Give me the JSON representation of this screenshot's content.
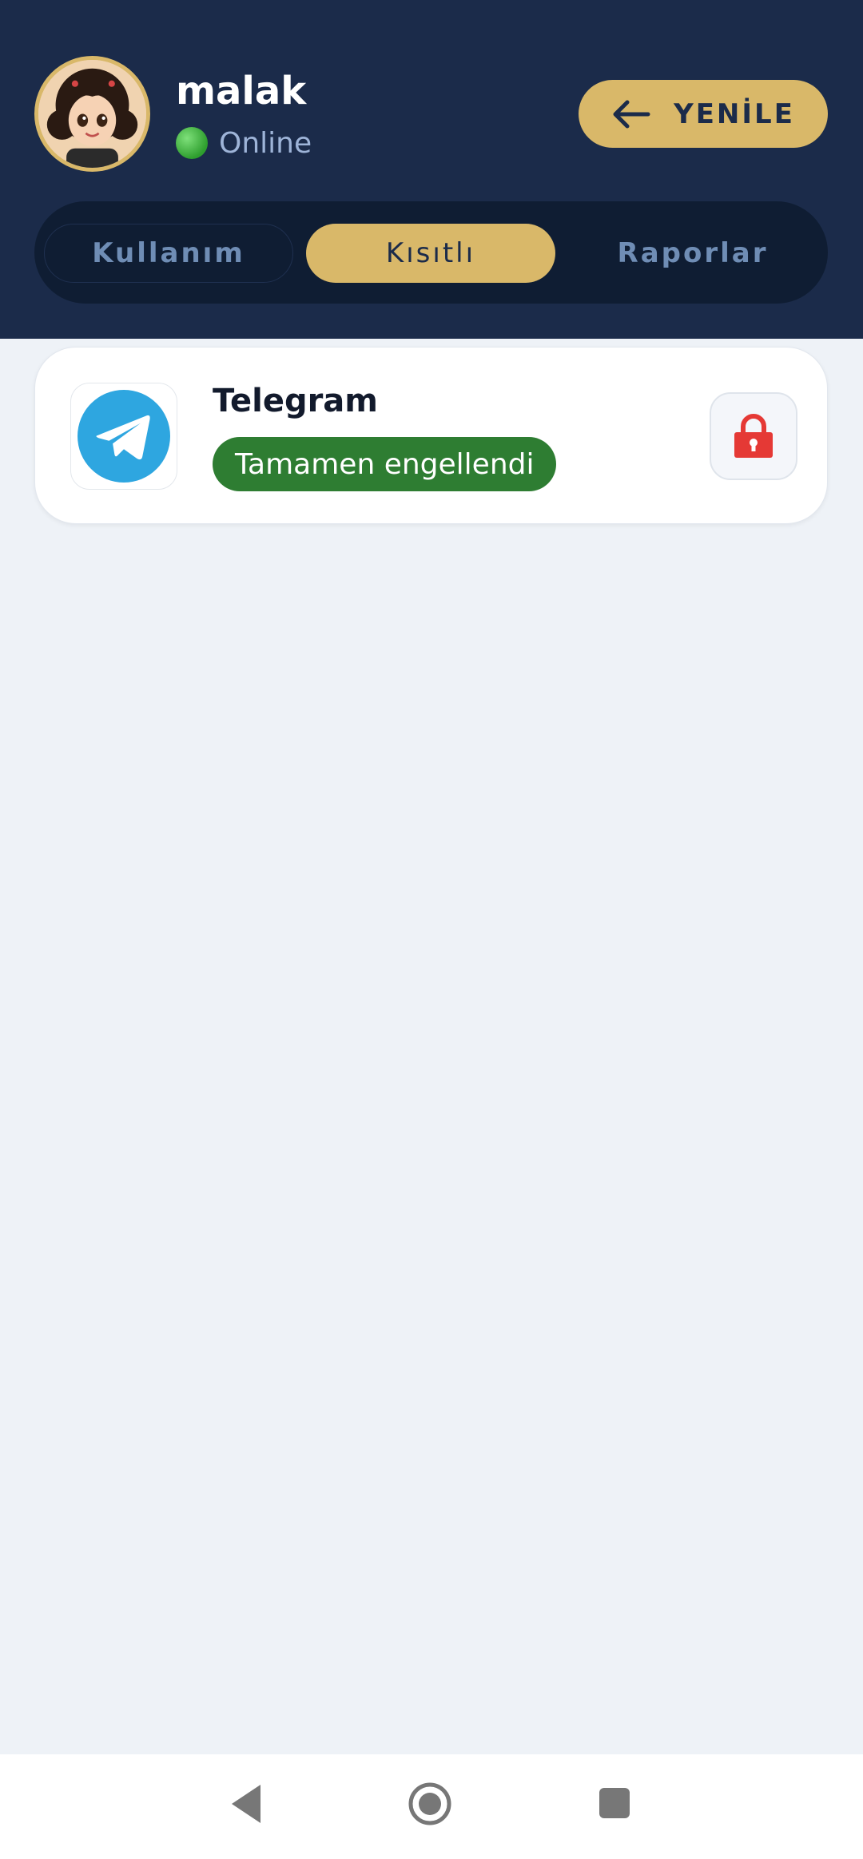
{
  "header": {
    "username": "malak",
    "status": "Online",
    "refresh_label": "YENİLE"
  },
  "tabs": [
    {
      "label": "Kullanım",
      "selected": false
    },
    {
      "label": "Kısıtlı",
      "selected": true
    },
    {
      "label": "Raporlar",
      "selected": false
    }
  ],
  "apps": [
    {
      "name": "Telegram",
      "status": "Tamamen engellendi",
      "icon": "telegram-icon",
      "lock_icon": "lock-icon"
    }
  ],
  "colors": {
    "header_bg": "#1b2b4a",
    "accent_gold": "#d9b869",
    "blocked_green": "#2e7d32",
    "lock_red": "#e53935",
    "telegram_blue": "#2ea6e0"
  },
  "navigation": {
    "back_icon": "back-triangle-icon",
    "home_icon": "home-circle-icon",
    "recents_icon": "recents-square-icon"
  }
}
